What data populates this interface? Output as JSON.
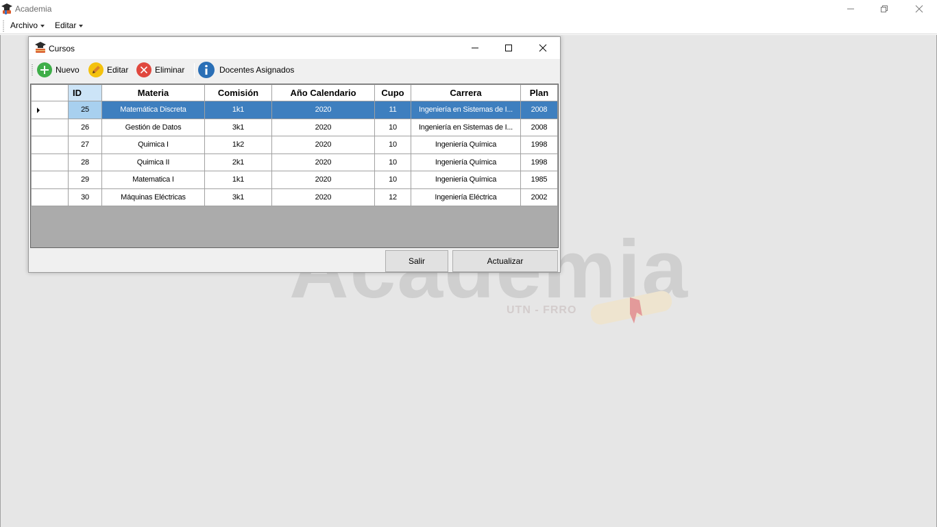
{
  "app": {
    "title": "Academia"
  },
  "menu": {
    "items": [
      {
        "label": "Archivo"
      },
      {
        "label": "Editar"
      }
    ]
  },
  "watermark": {
    "title": "Academia",
    "subtitle": "UTN - FRRO"
  },
  "child": {
    "title": "Cursos",
    "toolbar": {
      "nuevo": "Nuevo",
      "editar": "Editar",
      "eliminar": "Eliminar",
      "docentes": "Docentes Asignados"
    },
    "grid": {
      "columns": [
        "ID",
        "Materia",
        "Comisión",
        "Año Calendario",
        "Cupo",
        "Carrera",
        "Plan"
      ],
      "rows": [
        [
          "25",
          "Matemática Discreta",
          "1k1",
          "2020",
          "11",
          "Ingeniería en Sistemas de I...",
          "2008"
        ],
        [
          "26",
          "Gestión de Datos",
          "3k1",
          "2020",
          "10",
          "Ingeniería en Sistemas de I...",
          "2008"
        ],
        [
          "27",
          "Quimica I",
          "1k2",
          "2020",
          "10",
          "Ingeniería Química",
          "1998"
        ],
        [
          "28",
          "Quimica II",
          "2k1",
          "2020",
          "10",
          "Ingeniería Química",
          "1998"
        ],
        [
          "29",
          "Matematica I",
          "1k1",
          "2020",
          "10",
          "Ingeniería Química",
          "1985"
        ],
        [
          "30",
          "Máquinas Eléctricas",
          "3k1",
          "2020",
          "12",
          "Ingeniería Eléctrica",
          "2002"
        ]
      ],
      "selected_row": 0
    },
    "buttons": {
      "salir": "Salir",
      "actualizar": "Actualizar"
    }
  },
  "colors": {
    "selection": "#3e7fbf",
    "mdi_background": "#e6e6e6",
    "grid_background": "#ababab"
  }
}
